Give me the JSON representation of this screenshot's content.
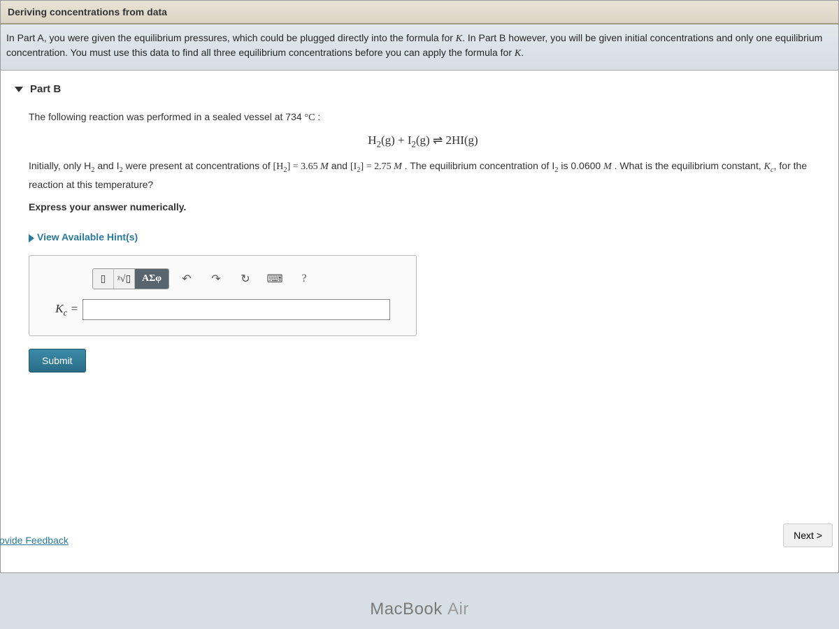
{
  "section_header": "Deriving concentrations from data",
  "intro_text_1": "In Part A, you were given the equilibrium pressures, which could be plugged directly into the formula for ",
  "intro_K1": "K",
  "intro_text_2": ". In Part B however, you will be given initial concentrations and only one equilibrium concentration. You must use this data to find all three equilibrium concentrations before you can apply the formula for ",
  "intro_K2": "K",
  "intro_text_3": ".",
  "part_label": "Part B",
  "q_line1_a": "The following reaction was performed in a sealed vessel at 734 ",
  "q_line1_deg": "°C",
  "q_line1_b": " :",
  "equation": "H₂(g) + I₂(g) ⇌ 2HI(g)",
  "q_line2_a": "Initially, only H",
  "q_line2_b": " and I",
  "q_line2_c": " were present at concentrations of ",
  "q_h2": "[H₂]",
  "q_eq1": " = 3.65 ",
  "q_M1": "M",
  "q_and": " and  ",
  "q_i2": "[I₂]",
  "q_eq2": " = 2.75 ",
  "q_M2": "M",
  "q_line2_d": " . The equilibrium concentration of I",
  "q_line2_e": " is 0.0600 ",
  "q_M3": "M",
  "q_line2_f": " . What is the equilibrium constant, ",
  "q_Kc": "K",
  "q_Kc_sub": "c",
  "q_line2_g": ", for the reaction at this temperature?",
  "instruction": "Express your answer numerically.",
  "hints_label": "View Available Hint(s)",
  "toolbar": {
    "templates_icon": "▯",
    "root_icon": "ᵡ√▯",
    "greek_label": "ΑΣφ",
    "undo_icon": "↶",
    "redo_icon": "↷",
    "reset_icon": "↻",
    "keyboard_icon": "⌨",
    "help_icon": "?"
  },
  "kc_prefix": "K",
  "kc_sub": "c",
  "kc_eq": " =",
  "answer_value": "",
  "submit_label": "Submit",
  "feedback_label": "ovide Feedback",
  "next_label": "Next >",
  "device_label_1": "MacBook",
  "device_label_2": "Air"
}
